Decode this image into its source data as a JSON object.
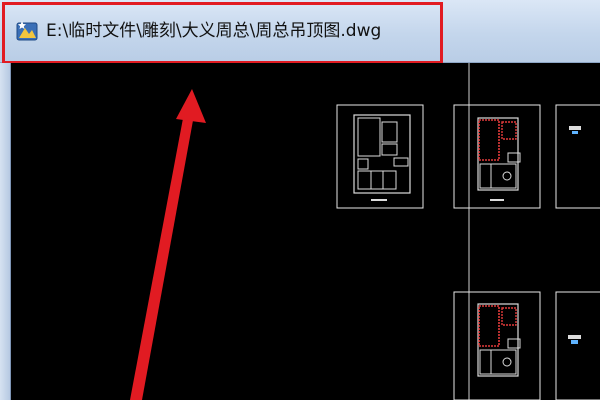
{
  "window": {
    "title": "E:\\临时文件\\雕刻\\大义周总\\周总吊顶图.dwg",
    "app_icon": "autocad-dwg-icon"
  },
  "annotation": {
    "color": "#e11b22",
    "box_target": "title-bar-path",
    "arrow_target": "title-bar-path"
  },
  "canvas": {
    "background": "#000000",
    "drawing_sheets": [
      "sheet-layout-plan",
      "sheet-ceiling-plan-1",
      "sheet-elevation-1",
      "sheet-ceiling-plan-2",
      "sheet-elevation-2"
    ]
  }
}
